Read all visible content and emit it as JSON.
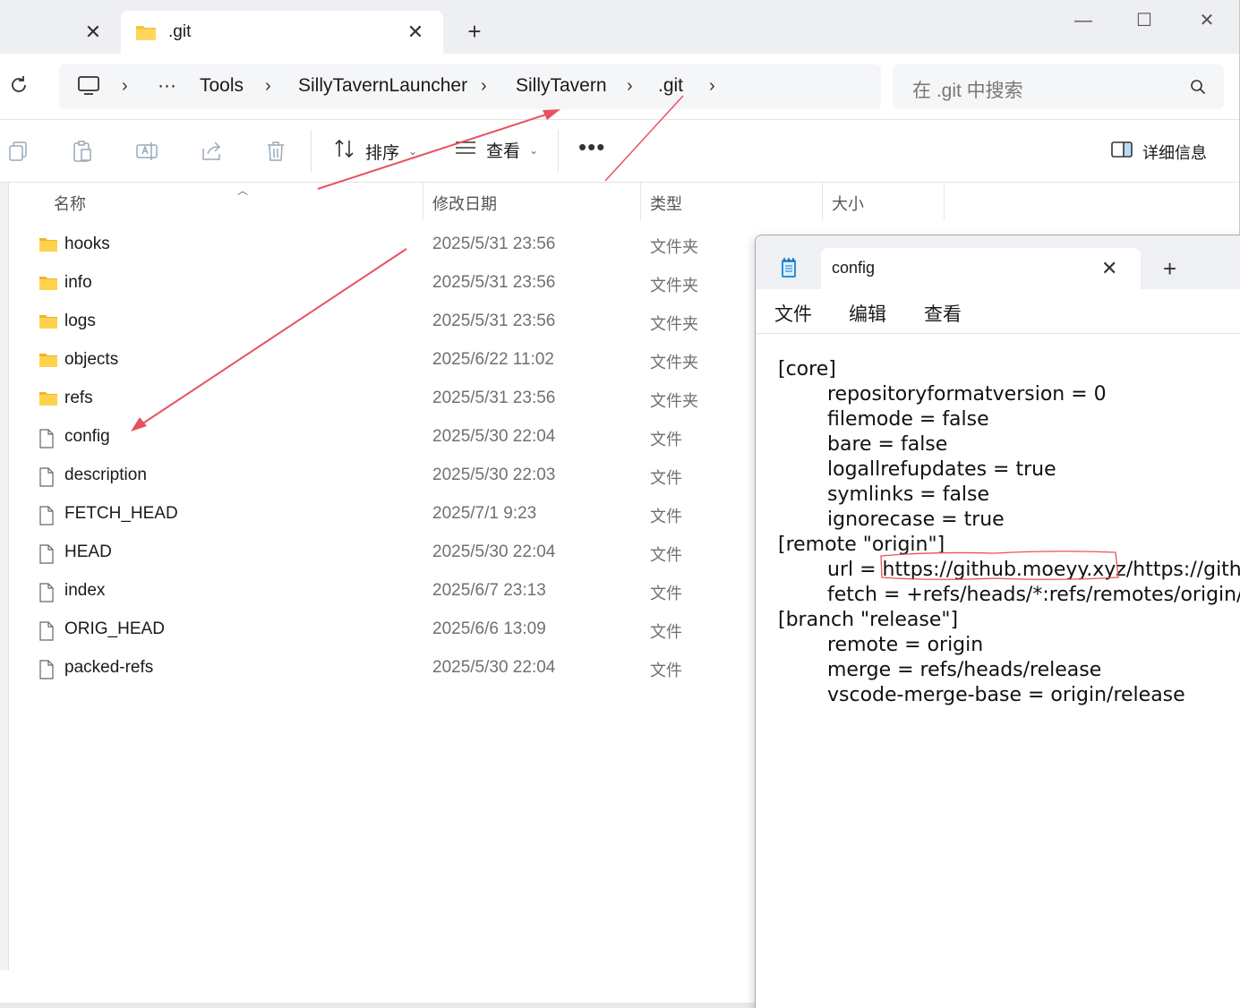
{
  "explorer": {
    "tabs": [
      {
        "label": ""
      },
      {
        "label": ".git"
      }
    ],
    "window_controls": {
      "minimize": "—",
      "maximize": "☐",
      "close": "✕"
    },
    "breadcrumb": [
      "Tools",
      "SillyTavernLauncher",
      "SillyTavern",
      ".git"
    ],
    "breadcrumb_more": "···",
    "search_placeholder": "在 .git 中搜索",
    "toolbar": {
      "sort_label": "排序",
      "view_label": "查看",
      "more": "•••",
      "details_label": "详细信息"
    },
    "columns": {
      "name": "名称",
      "date": "修改日期",
      "type": "类型",
      "size": "大小"
    },
    "files": [
      {
        "name": "hooks",
        "date": "2025/5/31 23:56",
        "type": "文件夹",
        "kind": "folder"
      },
      {
        "name": "info",
        "date": "2025/5/31 23:56",
        "type": "文件夹",
        "kind": "folder"
      },
      {
        "name": "logs",
        "date": "2025/5/31 23:56",
        "type": "文件夹",
        "kind": "folder"
      },
      {
        "name": "objects",
        "date": "2025/6/22 11:02",
        "type": "文件夹",
        "kind": "folder"
      },
      {
        "name": "refs",
        "date": "2025/5/31 23:56",
        "type": "文件夹",
        "kind": "folder"
      },
      {
        "name": "config",
        "date": "2025/5/30 22:04",
        "type": "文件",
        "kind": "file"
      },
      {
        "name": "description",
        "date": "2025/5/30 22:03",
        "type": "文件",
        "kind": "file"
      },
      {
        "name": "FETCH_HEAD",
        "date": "2025/7/1 9:23",
        "type": "文件",
        "kind": "file"
      },
      {
        "name": "HEAD",
        "date": "2025/5/30 22:04",
        "type": "文件",
        "kind": "file"
      },
      {
        "name": "index",
        "date": "2025/6/7 23:13",
        "type": "文件",
        "kind": "file"
      },
      {
        "name": "ORIG_HEAD",
        "date": "2025/6/6 13:09",
        "type": "文件",
        "kind": "file"
      },
      {
        "name": "packed-refs",
        "date": "2025/5/30 22:04",
        "type": "文件",
        "kind": "file"
      }
    ]
  },
  "notepad": {
    "tab_title": "config",
    "menu": [
      "文件",
      "编辑",
      "查看"
    ],
    "lines": [
      {
        "indent": false,
        "text": "[core]"
      },
      {
        "indent": true,
        "text": "repositoryformatversion = 0"
      },
      {
        "indent": true,
        "text": "filemode = false"
      },
      {
        "indent": true,
        "text": "bare = false"
      },
      {
        "indent": true,
        "text": "logallrefupdates = true"
      },
      {
        "indent": true,
        "text": "symlinks = false"
      },
      {
        "indent": true,
        "text": "ignorecase = true"
      },
      {
        "indent": false,
        "text": "[remote \"origin\"]"
      },
      {
        "indent": true,
        "text": "url = https://github.moeyy.xyz/https://github"
      },
      {
        "indent": true,
        "text": "fetch = +refs/heads/*:refs/remotes/origin/*"
      },
      {
        "indent": false,
        "text": "[branch \"release\"]"
      },
      {
        "indent": true,
        "text": "remote = origin"
      },
      {
        "indent": true,
        "text": "merge = refs/heads/release"
      },
      {
        "indent": true,
        "text": "vscode-merge-base = origin/release"
      }
    ]
  },
  "colors": {
    "folder": "#f8c63e",
    "annotation": "#e8525f",
    "accent": "#0067c0"
  }
}
